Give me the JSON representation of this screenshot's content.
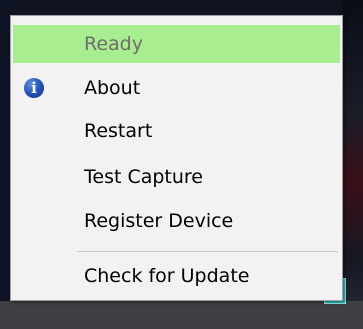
{
  "menu": {
    "items": [
      {
        "label": "Ready",
        "state": "disabled-highlighted"
      },
      {
        "label": "About",
        "icon": "info-icon"
      },
      {
        "label": "Restart"
      },
      {
        "label": "Test Capture"
      },
      {
        "label": "Register Device"
      },
      {
        "label": "Check for Update"
      }
    ]
  },
  "icons": {
    "info_glyph": "i",
    "tray": "app-tray-icon"
  },
  "colors": {
    "highlight": "#a8ee90",
    "menu_bg": "#f2f2f2",
    "info_icon": "#1f4fb7",
    "tray_icon": "#29c2c6"
  }
}
